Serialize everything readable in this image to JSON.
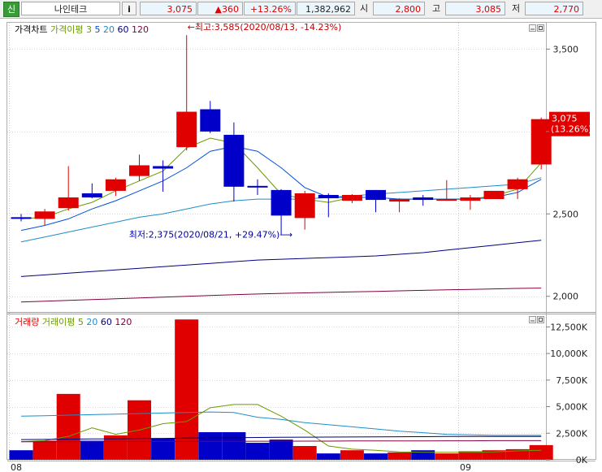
{
  "header": {
    "market_badge": "신",
    "stock_name": "나인테크",
    "info_button": "i",
    "price": "3,075",
    "change": "▲360",
    "change_pct": "+13.26%",
    "volume": "1,382,962",
    "open_label": "시",
    "open": "2,800",
    "high_label": "고",
    "high": "3,085",
    "low_label": "저",
    "low": "2,770"
  },
  "colors": {
    "up": "#e00000",
    "down": "#0000c8",
    "ma3": "#6a9a00",
    "ma5": "#0050e0",
    "ma20": "#1e8ec8",
    "ma60": "#000080",
    "ma120": "#800040",
    "vma5": "#6a9a00",
    "vma20": "#1e8ec8",
    "vma60": "#000080",
    "vma120": "#800040"
  },
  "price_legend": [
    {
      "text": "가격차트",
      "color": "#000000"
    },
    {
      "text": "가격이평",
      "color": "#6a9a00"
    },
    {
      "text": "3",
      "color": "#6a9a00"
    },
    {
      "text": "5",
      "color": "#0050e0"
    },
    {
      "text": "20",
      "color": "#1e8ec8"
    },
    {
      "text": "60",
      "color": "#000080"
    },
    {
      "text": "120",
      "color": "#800040"
    }
  ],
  "volume_legend": [
    {
      "text": "거래량",
      "color": "#e00000"
    },
    {
      "text": "거래이평",
      "color": "#6a9a00"
    },
    {
      "text": "5",
      "color": "#6a9a00"
    },
    {
      "text": "20",
      "color": "#1e8ec8"
    },
    {
      "text": "60",
      "color": "#000080"
    },
    {
      "text": "120",
      "color": "#800040"
    }
  ],
  "chart_data": [
    {
      "type": "candlestick",
      "y_ticks": [
        2000,
        2500,
        3000,
        3500
      ],
      "y_tick_labels": [
        "2,000",
        "2,500",
        "3,000",
        "3,500"
      ],
      "ylim": [
        1910,
        3660
      ],
      "candles": [
        {
          "o": 2480,
          "h": 2500,
          "l": 2455,
          "c": 2470
        },
        {
          "o": 2470,
          "h": 2530,
          "l": 2430,
          "c": 2515
        },
        {
          "o": 2535,
          "h": 2790,
          "l": 2520,
          "c": 2600
        },
        {
          "o": 2625,
          "h": 2685,
          "l": 2595,
          "c": 2600
        },
        {
          "o": 2640,
          "h": 2720,
          "l": 2610,
          "c": 2710
        },
        {
          "o": 2730,
          "h": 2860,
          "l": 2700,
          "c": 2795
        },
        {
          "o": 2790,
          "h": 2825,
          "l": 2635,
          "c": 2775
        },
        {
          "o": 2905,
          "h": 3585,
          "l": 2885,
          "c": 3120
        },
        {
          "o": 3135,
          "h": 3185,
          "l": 2990,
          "c": 3000
        },
        {
          "o": 2980,
          "h": 3055,
          "l": 2575,
          "c": 2665
        },
        {
          "o": 2670,
          "h": 2710,
          "l": 2615,
          "c": 2665
        },
        {
          "o": 2645,
          "h": 2650,
          "l": 2375,
          "c": 2490
        },
        {
          "o": 2475,
          "h": 2640,
          "l": 2405,
          "c": 2625
        },
        {
          "o": 2615,
          "h": 2625,
          "l": 2480,
          "c": 2595
        },
        {
          "o": 2580,
          "h": 2620,
          "l": 2565,
          "c": 2615
        },
        {
          "o": 2645,
          "h": 2645,
          "l": 2510,
          "c": 2585
        },
        {
          "o": 2575,
          "h": 2595,
          "l": 2510,
          "c": 2590
        },
        {
          "o": 2600,
          "h": 2615,
          "l": 2550,
          "c": 2585
        },
        {
          "o": 2590,
          "h": 2705,
          "l": 2580,
          "c": 2590
        },
        {
          "o": 2580,
          "h": 2615,
          "l": 2525,
          "c": 2600
        },
        {
          "o": 2590,
          "h": 2640,
          "l": 2590,
          "c": 2640
        },
        {
          "o": 2650,
          "h": 2720,
          "l": 2590,
          "c": 2710
        },
        {
          "o": 2800,
          "h": 3085,
          "l": 2770,
          "c": 3075
        }
      ],
      "ma": [
        {
          "period": "3",
          "color": "#6a9a00",
          "values": [
            2470,
            2480,
            2530,
            2570,
            2640,
            2700,
            2760,
            2900,
            2960,
            2930,
            2780,
            2620,
            2590,
            2570,
            2600,
            2600,
            2590,
            2590,
            2590,
            2590,
            2610,
            2650,
            2810
          ]
        },
        {
          "period": "5",
          "color": "#0050e0",
          "values": [
            2400,
            2430,
            2470,
            2530,
            2580,
            2640,
            2700,
            2780,
            2880,
            2910,
            2880,
            2780,
            2660,
            2600,
            2600,
            2600,
            2590,
            2590,
            2590,
            2590,
            2600,
            2630,
            2710
          ]
        },
        {
          "period": "20",
          "color": "#1e8ec8",
          "values": [
            2330,
            2360,
            2390,
            2420,
            2450,
            2480,
            2500,
            2530,
            2560,
            2580,
            2590,
            2590,
            2590,
            2600,
            2610,
            2620,
            2630,
            2640,
            2650,
            2660,
            2670,
            2680,
            2720
          ]
        },
        {
          "period": "60",
          "color": "#000080",
          "values": [
            2120,
            2130,
            2140,
            2150,
            2160,
            2170,
            2180,
            2190,
            2200,
            2210,
            2220,
            2225,
            2230,
            2235,
            2240,
            2245,
            2255,
            2265,
            2280,
            2295,
            2310,
            2325,
            2340
          ]
        },
        {
          "period": "120",
          "color": "#800040",
          "values": [
            1965,
            1970,
            1975,
            1980,
            1985,
            1990,
            1995,
            2000,
            2005,
            2010,
            2014,
            2018,
            2021,
            2024,
            2027,
            2030,
            2033,
            2036,
            2039,
            2042,
            2045,
            2048,
            2050
          ]
        }
      ],
      "annotations": {
        "high": {
          "index": 7,
          "value": 3585,
          "text": "←최고:3,585(2020/08/13, -14.23%)"
        },
        "low": {
          "index": 11,
          "value": 2375,
          "text": "최저:2,375(2020/08/21, +29.47%)⟶"
        }
      },
      "current_price_label": {
        "value": 3075,
        "line1": "3,075",
        "line2": "(13.26%)"
      }
    },
    {
      "type": "bar",
      "y_ticks": [
        0,
        2500,
        5000,
        7500,
        10000,
        12500
      ],
      "y_tick_labels": [
        "0K",
        "2,500K",
        "5,000K",
        "7,500K",
        "10,000K",
        "12,500K"
      ],
      "ylim": [
        0,
        13600
      ],
      "values": [
        900,
        1800,
        6200,
        1800,
        2300,
        5600,
        2000,
        13200,
        2600,
        2600,
        1600,
        1900,
        1300,
        600,
        900,
        600,
        700,
        900,
        600,
        800,
        900,
        1000,
        1383
      ],
      "vma": [
        {
          "period": "5",
          "color": "#6a9a00",
          "values": [
            1700,
            1800,
            2200,
            3000,
            2400,
            2800,
            3400,
            3600,
            4900,
            5200,
            5200,
            4100,
            2800,
            1300,
            1000,
            900,
            750,
            700,
            700,
            700,
            750,
            850,
            900
          ]
        },
        {
          "period": "20",
          "color": "#1e8ec8",
          "values": [
            4100,
            4150,
            4200,
            4250,
            4300,
            4350,
            4400,
            4450,
            4500,
            4450,
            4000,
            3800,
            3500,
            3300,
            3100,
            2900,
            2700,
            2550,
            2400,
            2350,
            2300,
            2300,
            2300
          ]
        },
        {
          "period": "60",
          "color": "#000080",
          "values": [
            1900,
            1920,
            1940,
            1960,
            1980,
            2000,
            2020,
            2040,
            2060,
            2080,
            2100,
            2120,
            2130,
            2140,
            2150,
            2160,
            2170,
            2180,
            2190,
            2200,
            2200,
            2200,
            2200
          ]
        },
        {
          "period": "120",
          "color": "#800040",
          "values": [
            1700,
            1700,
            1710,
            1710,
            1720,
            1720,
            1730,
            1730,
            1740,
            1740,
            1750,
            1750,
            1760,
            1760,
            1770,
            1770,
            1780,
            1780,
            1790,
            1790,
            1800,
            1800,
            1800
          ]
        }
      ]
    }
  ],
  "x_axis": {
    "labels": [
      {
        "text": "08",
        "index": 0
      },
      {
        "text": "09",
        "index": 19
      }
    ]
  }
}
